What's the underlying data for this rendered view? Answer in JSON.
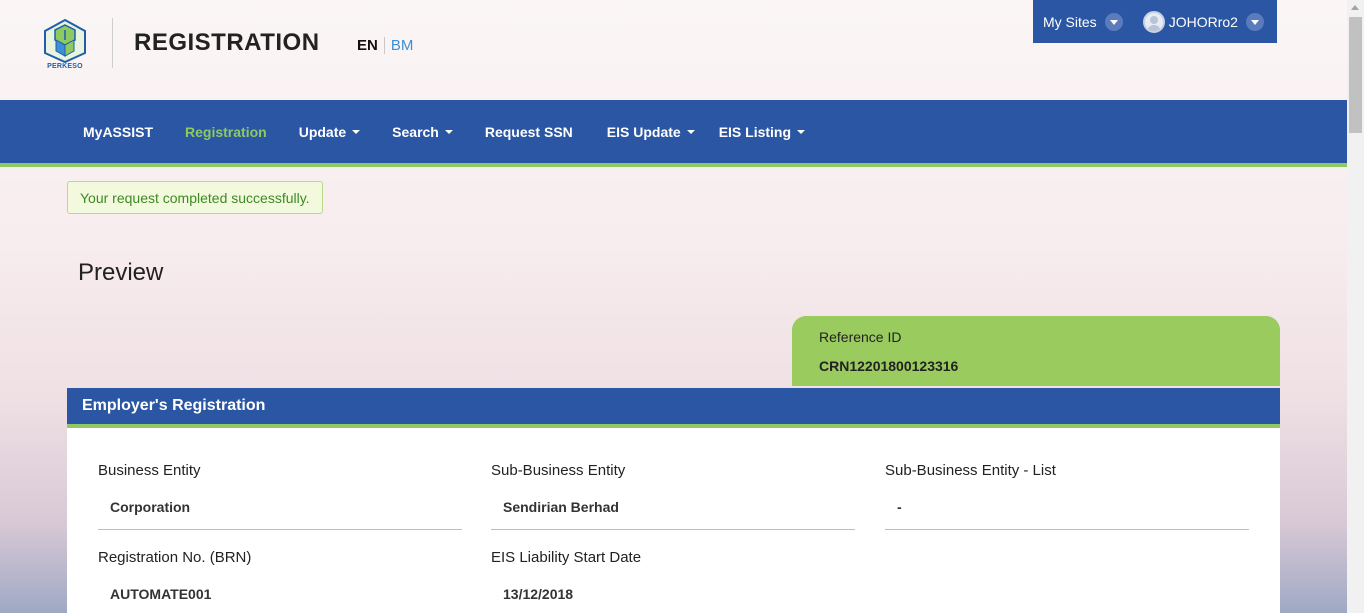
{
  "header": {
    "logo_text": "PERKESO",
    "title": "REGISTRATION",
    "lang_en": "EN",
    "lang_bm": "BM"
  },
  "topbar": {
    "my_sites": "My Sites",
    "user": "JOHORro2"
  },
  "nav": {
    "items": [
      {
        "label": "MyASSIST"
      },
      {
        "label": "Registration"
      },
      {
        "label": "Update"
      },
      {
        "label": "Search"
      },
      {
        "label": "Request SSN"
      },
      {
        "label": "EIS Update"
      },
      {
        "label": "EIS Listing"
      }
    ]
  },
  "alert": "Your request completed successfully.",
  "page_heading": "Preview",
  "reference": {
    "label": "Reference ID",
    "value": "CRN12201800123316"
  },
  "panel": {
    "title": "Employer's Registration",
    "fields": [
      {
        "label": "Business Entity",
        "value": "Corporation"
      },
      {
        "label": "Sub-Business Entity",
        "value": "Sendirian Berhad"
      },
      {
        "label": "Sub-Business Entity - List",
        "value": "-"
      },
      {
        "label": "Registration No. (BRN)",
        "value": "AUTOMATE001"
      },
      {
        "label": "EIS Liability Start Date",
        "value": "13/12/2018"
      }
    ]
  },
  "colors": {
    "primary": "#2b56a3",
    "accent_green": "#8ec963",
    "reference_box": "#99cb5e"
  }
}
